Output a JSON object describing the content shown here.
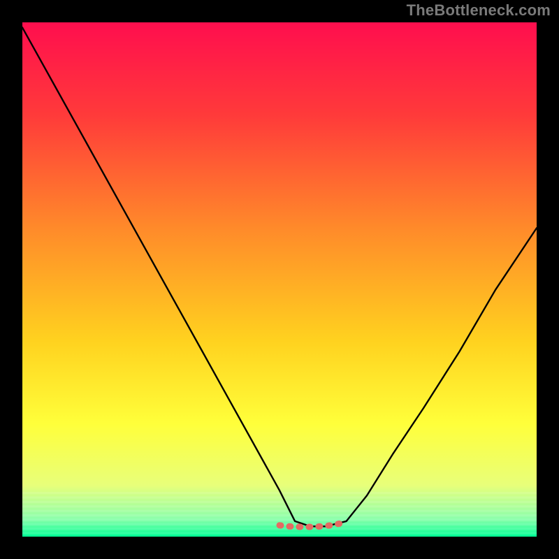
{
  "watermark": "TheBottleneck.com",
  "colors": {
    "frame": "#000000",
    "watermark": "#7a7a7a",
    "curve": "#000000",
    "marker": "#e46a62",
    "gradient_stops": [
      {
        "offset": 0.0,
        "color": "#ff0e4e"
      },
      {
        "offset": 0.18,
        "color": "#ff3a3a"
      },
      {
        "offset": 0.4,
        "color": "#ff8a2a"
      },
      {
        "offset": 0.62,
        "color": "#ffd21f"
      },
      {
        "offset": 0.78,
        "color": "#ffff3a"
      },
      {
        "offset": 0.9,
        "color": "#e8ff7a"
      },
      {
        "offset": 0.965,
        "color": "#8dffab"
      },
      {
        "offset": 1.0,
        "color": "#00ff95"
      }
    ]
  },
  "chart_data": {
    "type": "line",
    "title": "",
    "xlabel": "",
    "ylabel": "",
    "xlim": [
      0,
      100
    ],
    "ylim": [
      0,
      100
    ],
    "grid": false,
    "legend": false,
    "series": [
      {
        "name": "bottleneck-curve",
        "x": [
          0,
          5,
          10,
          15,
          20,
          25,
          30,
          35,
          40,
          45,
          50,
          53,
          56,
          59,
          63,
          67,
          72,
          78,
          85,
          92,
          100
        ],
        "y": [
          99,
          90,
          81,
          72,
          63,
          54,
          45,
          36,
          27,
          18,
          9,
          3,
          2,
          2,
          3,
          8,
          16,
          25,
          36,
          48,
          60
        ]
      }
    ],
    "markers": {
      "name": "optimal-band",
      "x": [
        50,
        52,
        54,
        56,
        58,
        60,
        62
      ],
      "y": [
        2.2,
        2.0,
        1.9,
        1.9,
        2.0,
        2.2,
        2.6
      ]
    }
  }
}
